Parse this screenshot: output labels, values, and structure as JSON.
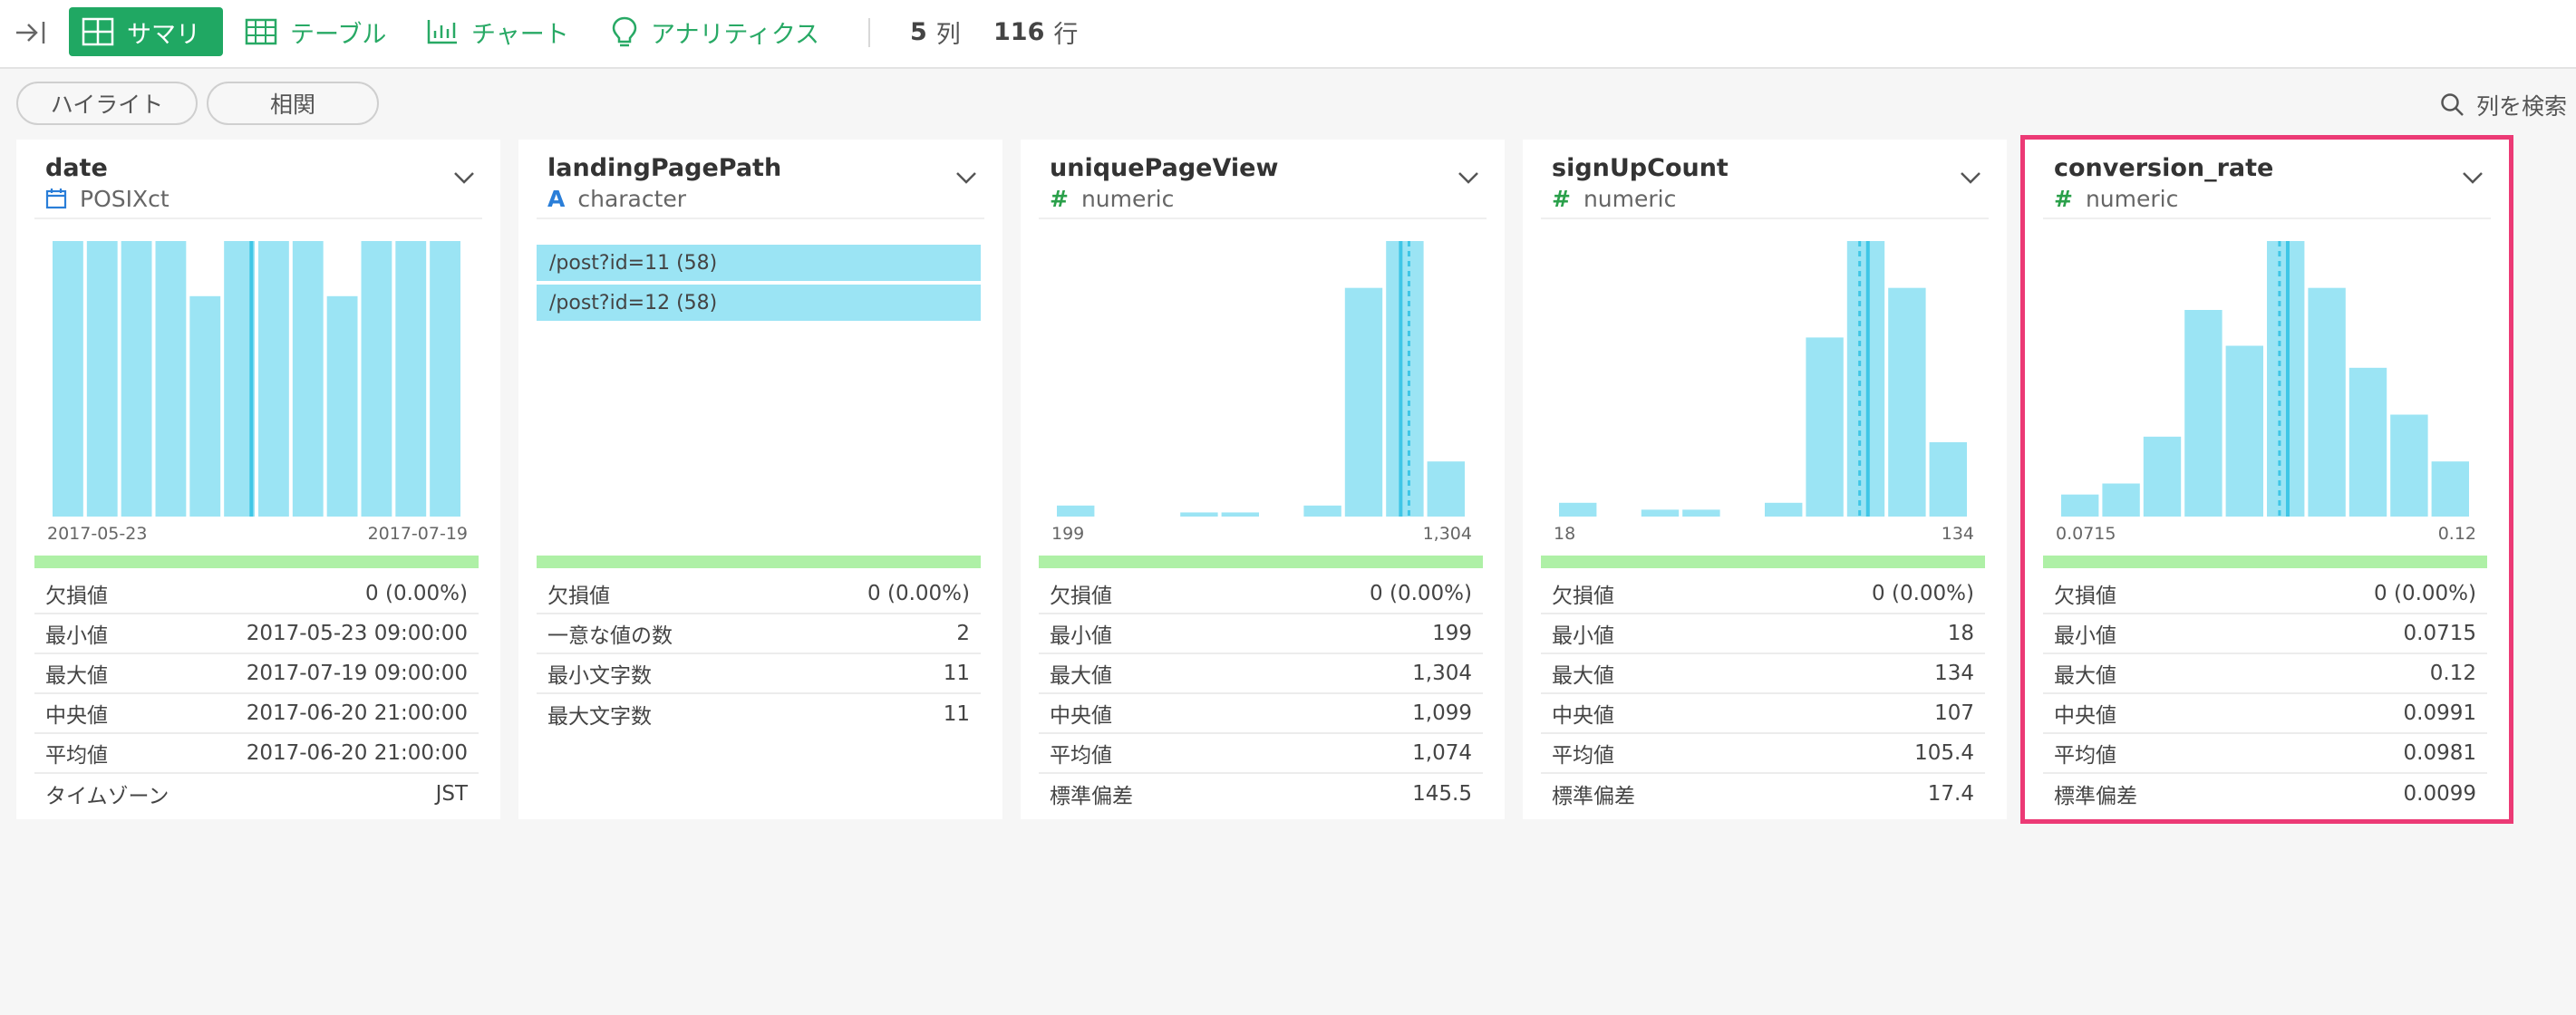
{
  "toolbar": {
    "tabs": [
      {
        "label": "サマリ",
        "icon": "summary-grid-icon",
        "active": true
      },
      {
        "label": "テーブル",
        "icon": "table-icon",
        "active": false
      },
      {
        "label": "チャート",
        "icon": "bar-chart-icon",
        "active": false
      },
      {
        "label": "アナリティクス",
        "icon": "lightbulb-icon",
        "active": false
      }
    ],
    "columns_count": "5",
    "columns_unit": "列",
    "rows_count": "116",
    "rows_unit": "行"
  },
  "subbar": {
    "highlight_label": "ハイライト",
    "correlation_label": "相関",
    "search_label": "列を検索"
  },
  "colors": {
    "accent": "#20a863",
    "bar": "#9be4f4",
    "median_line": "#3fc6e6",
    "valid_bar": "#aef0a6",
    "highlight_outline": "#ec3a75"
  },
  "columns": [
    {
      "name": "date",
      "type": "POSIXct",
      "type_icon": "calendar-icon",
      "axis_min": "2017-05-23",
      "axis_max": "2017-07-19",
      "stats": [
        {
          "label": "欠損値",
          "value": "0 (0.00%)"
        },
        {
          "label": "最小値",
          "value": "2017-05-23 09:00:00"
        },
        {
          "label": "最大値",
          "value": "2017-07-19 09:00:00"
        },
        {
          "label": "中央値",
          "value": "2017-06-20 21:00:00"
        },
        {
          "label": "平均値",
          "value": "2017-06-20 21:00:00"
        },
        {
          "label": "タイムゾーン",
          "value": "JST"
        }
      ]
    },
    {
      "name": "landingPagePath",
      "type": "character",
      "type_icon": "text-type-icon",
      "top_values": [
        "/post?id=11 (58)",
        "/post?id=12 (58)"
      ],
      "stats": [
        {
          "label": "欠損値",
          "value": "0 (0.00%)"
        },
        {
          "label": "一意な値の数",
          "value": "2"
        },
        {
          "label": "最小文字数",
          "value": "11"
        },
        {
          "label": "最大文字数",
          "value": "11"
        }
      ]
    },
    {
      "name": "uniquePageView",
      "type": "numeric",
      "type_icon": "numeric-hash-icon",
      "axis_min": "199",
      "axis_max": "1,304",
      "stats": [
        {
          "label": "欠損値",
          "value": "0 (0.00%)"
        },
        {
          "label": "最小値",
          "value": "199"
        },
        {
          "label": "最大値",
          "value": "1,304"
        },
        {
          "label": "中央値",
          "value": "1,099"
        },
        {
          "label": "平均値",
          "value": "1,074"
        },
        {
          "label": "標準偏差",
          "value": "145.5"
        }
      ]
    },
    {
      "name": "signUpCount",
      "type": "numeric",
      "type_icon": "numeric-hash-icon",
      "axis_min": "18",
      "axis_max": "134",
      "stats": [
        {
          "label": "欠損値",
          "value": "0 (0.00%)"
        },
        {
          "label": "最小値",
          "value": "18"
        },
        {
          "label": "最大値",
          "value": "134"
        },
        {
          "label": "中央値",
          "value": "107"
        },
        {
          "label": "平均値",
          "value": "105.4"
        },
        {
          "label": "標準偏差",
          "value": "17.4"
        }
      ]
    },
    {
      "name": "conversion_rate",
      "type": "numeric",
      "type_icon": "numeric-hash-icon",
      "axis_min": "0.0715",
      "axis_max": "0.12",
      "stats": [
        {
          "label": "欠損値",
          "value": "0 (0.00%)"
        },
        {
          "label": "最小値",
          "value": "0.0715"
        },
        {
          "label": "最大値",
          "value": "0.12"
        },
        {
          "label": "中央値",
          "value": "0.0991"
        },
        {
          "label": "平均値",
          "value": "0.0981"
        },
        {
          "label": "標準偏差",
          "value": "0.0099"
        }
      ]
    }
  ],
  "chart_data": [
    {
      "type": "bar",
      "column": "date",
      "values": [
        1.0,
        1.0,
        1.0,
        1.0,
        0.8,
        1.0,
        1.0,
        1.0,
        0.8,
        1.0,
        1.0,
        1.0
      ],
      "median_bin": 5.85,
      "mean_bin": null
    },
    {
      "type": "bar",
      "column": "uniquePageView",
      "values": [
        0.04,
        0,
        0,
        0.015,
        0.015,
        0,
        0.04,
        0.83,
        1.0,
        0.2
      ],
      "median_bin": 8.4,
      "mean_bin": 8.6
    },
    {
      "type": "bar",
      "column": "signUpCount",
      "values": [
        0.05,
        0,
        0.025,
        0.025,
        0,
        0.05,
        0.65,
        1.0,
        0.83,
        0.27
      ],
      "median_bin": 7.55,
      "mean_bin": 7.35
    },
    {
      "type": "bar",
      "column": "conversion_rate",
      "values": [
        0.08,
        0.12,
        0.29,
        0.75,
        0.62,
        1.0,
        0.83,
        0.54,
        0.37,
        0.2
      ],
      "median_bin": 5.55,
      "mean_bin": 5.35
    }
  ]
}
